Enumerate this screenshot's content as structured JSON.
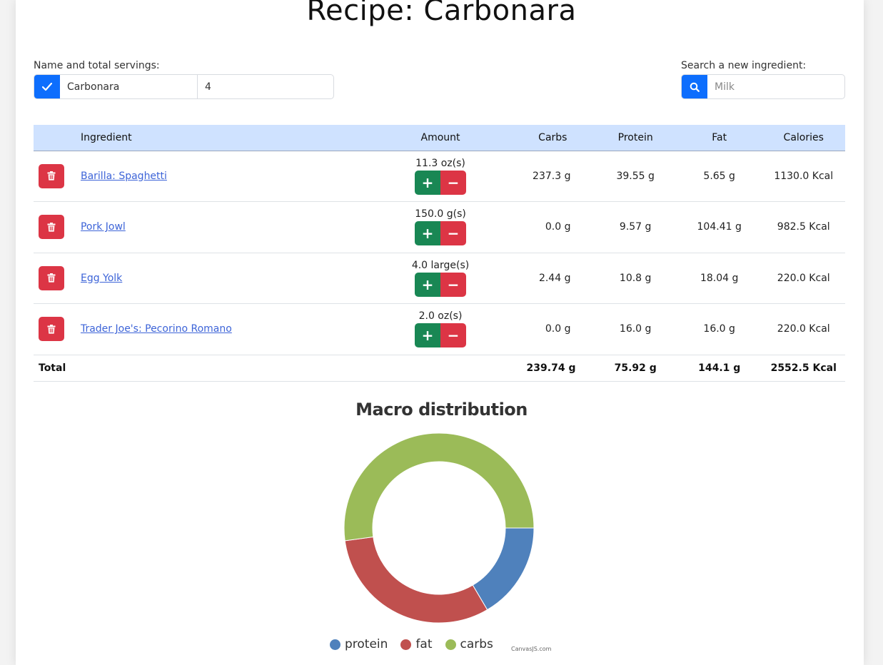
{
  "page": {
    "title": "Recipe: Carbonara"
  },
  "recipe_form": {
    "label": "Name and total servings:",
    "name_value": "Carbonara",
    "servings_value": "4"
  },
  "search": {
    "label": "Search a new ingredient:",
    "placeholder": "Milk"
  },
  "table": {
    "headers": [
      "Ingredient",
      "Amount",
      "Carbs",
      "Protein",
      "Fat",
      "Calories"
    ],
    "rows": [
      {
        "ingredient": "Barilla: Spaghetti",
        "amount": "11.3 oz(s)",
        "carbs": "237.3 g",
        "protein": "39.55 g",
        "fat": "5.65 g",
        "calories": "1130.0 Kcal"
      },
      {
        "ingredient": "Pork Jowl",
        "amount": "150.0 g(s)",
        "carbs": "0.0 g",
        "protein": "9.57 g",
        "fat": "104.41 g",
        "calories": "982.5 Kcal"
      },
      {
        "ingredient": "Egg Yolk",
        "amount": "4.0 large(s)",
        "carbs": "2.44 g",
        "protein": "10.8 g",
        "fat": "18.04 g",
        "calories": "220.0 Kcal"
      },
      {
        "ingredient": "Trader Joe's: Pecorino Romano",
        "amount": "2.0 oz(s)",
        "carbs": "0.0 g",
        "protein": "16.0 g",
        "fat": "16.0 g",
        "calories": "220.0 Kcal"
      }
    ],
    "total": {
      "label": "Total",
      "carbs": "239.74 g",
      "protein": "75.92 g",
      "fat": "144.1 g",
      "calories": "2552.5 Kcal"
    },
    "plus_label": "+",
    "minus_label": "−"
  },
  "colors": {
    "primary": "#0d6efd",
    "danger": "#dc3545",
    "success": "#198754",
    "header_bg": "#cfe2ff",
    "link": "#3d64d8"
  },
  "icons": {
    "confirm": "check-icon",
    "search": "search-icon",
    "delete": "trash-icon"
  },
  "chart_data": {
    "type": "pie",
    "variant": "doughnut",
    "title": "Macro distribution",
    "categories": [
      "protein",
      "fat",
      "carbs"
    ],
    "values": [
      75.92,
      144.1,
      239.74
    ],
    "colors": [
      "#4f81bc",
      "#c0504e",
      "#9bbb58"
    ],
    "legend": "bottom",
    "credit": "CanvasJS.com"
  }
}
